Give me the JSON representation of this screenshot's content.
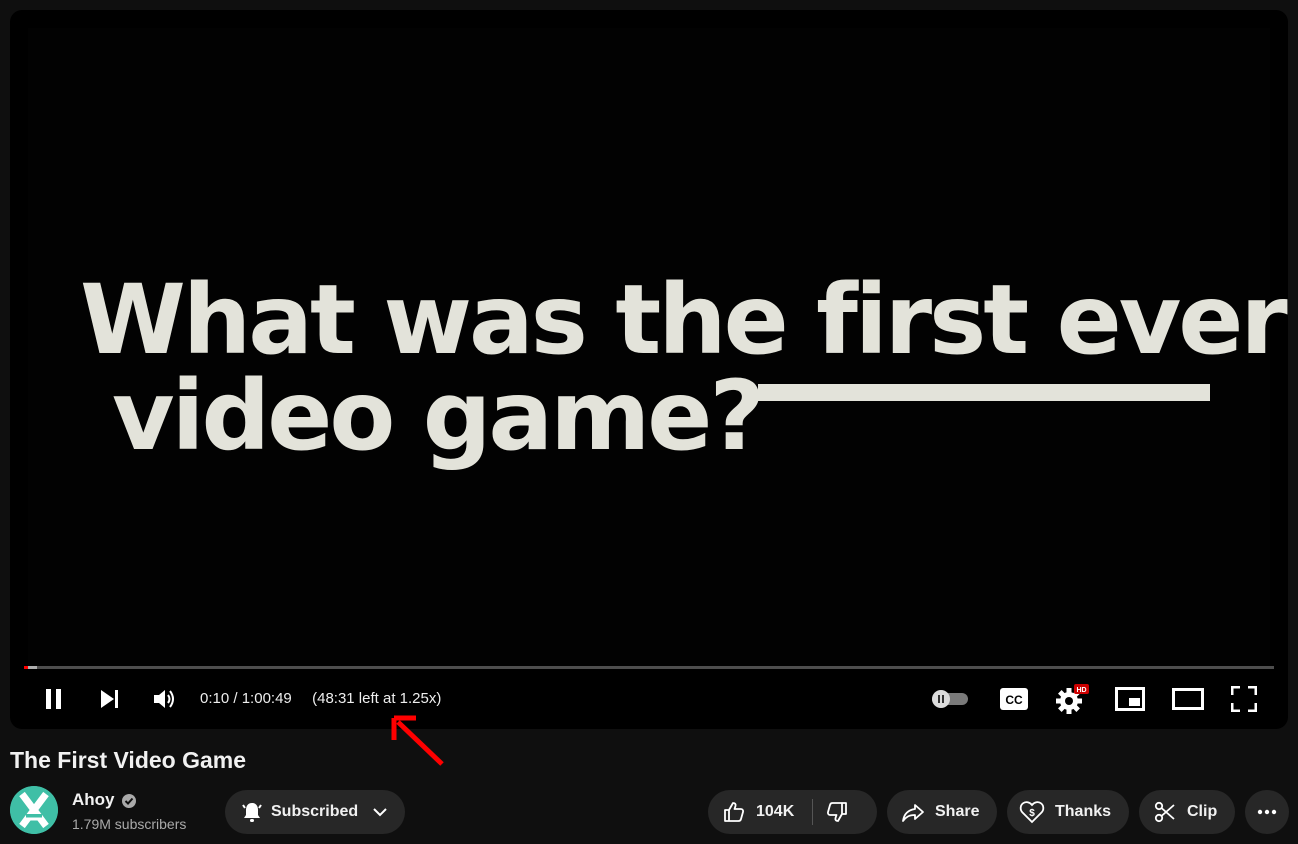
{
  "player": {
    "overlay_text": {
      "line1": "What was the first ever",
      "line2": "video game?"
    },
    "progress": {
      "played_fraction": 0.003,
      "buffered_fraction": 0.01
    },
    "current_time": "0:10",
    "separator": "/",
    "duration": "1:00:49",
    "time_left": "(48:31 left at 1.25x)",
    "settings_badge": "HD",
    "cc_label": "CC",
    "icons": [
      "pause-icon",
      "next-icon",
      "volume-icon",
      "autoplay-toggle",
      "cc-icon",
      "settings-icon",
      "miniplayer-icon",
      "theater-mode-icon",
      "fullscreen-icon"
    ]
  },
  "annotation": {
    "color": "#ff0000"
  },
  "video": {
    "title": "The First Video Game"
  },
  "channel": {
    "name": "Ahoy",
    "subscribers": "1.79M subscribers"
  },
  "actions": {
    "subscribe_label": "Subscribed",
    "like_count": "104K",
    "share_label": "Share",
    "thanks_label": "Thanks",
    "clip_label": "Clip"
  },
  "colors": {
    "accent": "#ff0000",
    "background": "#0f0f0f",
    "pill": "#272727",
    "avatar": "#3fbfa6"
  }
}
